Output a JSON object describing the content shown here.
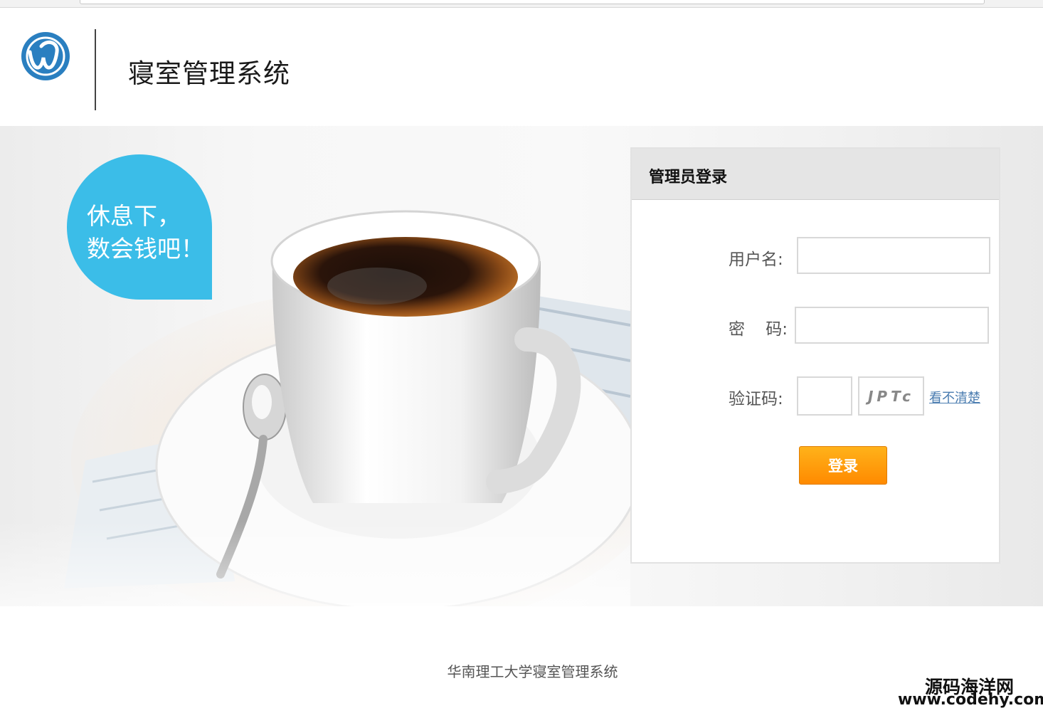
{
  "header": {
    "title": "寝室管理系统",
    "logo_icon": "w-circle-logo-icon"
  },
  "banner": {
    "bubble_text_line1": "休息下，",
    "bubble_text_line2": "数会钱吧！",
    "image": "coffee-cup-photo"
  },
  "login": {
    "title": "管理员登录",
    "username_label": "用户名:",
    "username_value": "",
    "password_label": "密    码:",
    "password_value": "",
    "captcha_label": "验证码:",
    "captcha_value": "",
    "captcha_image_text": "JPTc",
    "refresh_link": "看不清楚",
    "submit_label": "登录",
    "accent_color": "#ff9a00"
  },
  "footer": {
    "text": "华南理工大学寝室管理系统",
    "watermark_line1": "源码海洋网",
    "watermark_line2": "www.codehy.com"
  }
}
